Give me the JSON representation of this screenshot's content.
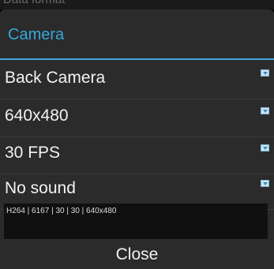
{
  "background": {
    "partial_text": "Data format"
  },
  "dialog": {
    "title": "Camera",
    "accent_color": "#34a8dc",
    "options": [
      {
        "label": "Back Camera",
        "icon": "dropdown-arrow-icon"
      },
      {
        "label": "640x480",
        "icon": "dropdown-arrow-icon"
      },
      {
        "label": "30 FPS",
        "icon": "dropdown-arrow-icon"
      },
      {
        "label": "No sound",
        "icon": "dropdown-arrow-icon"
      }
    ],
    "status": "H264 | 6167 | 30 | 30 | 640x480",
    "close_label": "Close"
  }
}
